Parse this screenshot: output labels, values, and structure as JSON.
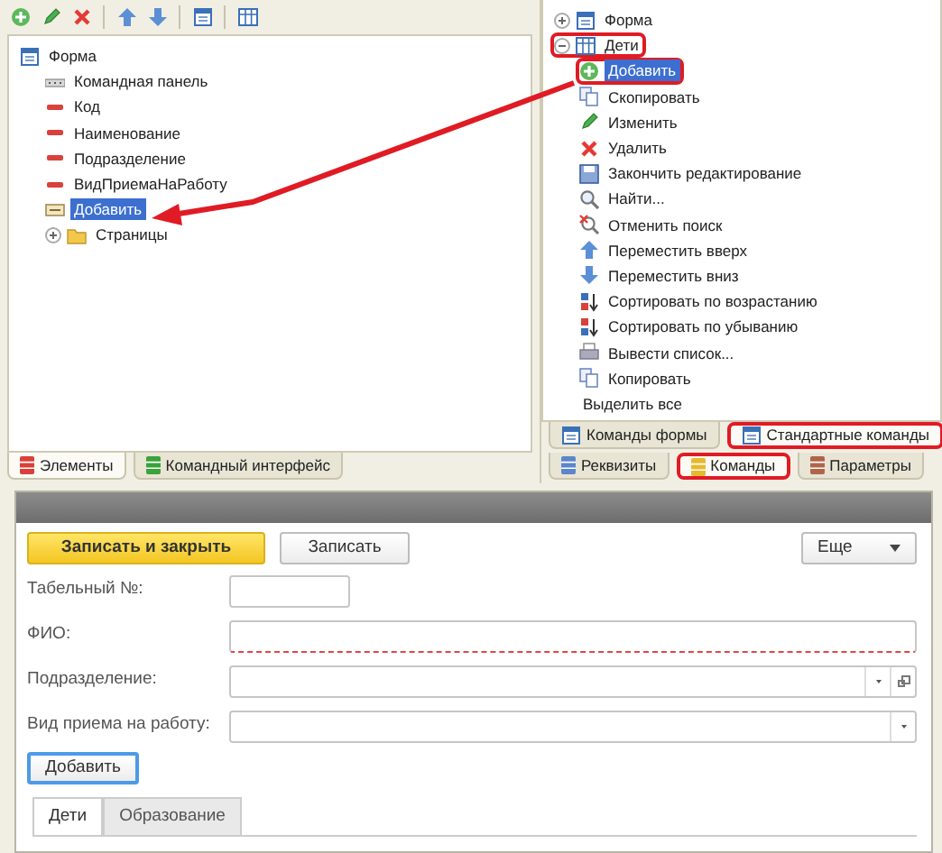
{
  "elements_panel": {
    "tree": [
      {
        "label": "Форма",
        "kind": "form",
        "selected": false,
        "children": [
          {
            "label": "Командная панель",
            "kind": "command-panel",
            "selected": false
          },
          {
            "label": "Код",
            "kind": "field",
            "selected": false
          },
          {
            "label": "Наименование",
            "kind": "field",
            "selected": false
          },
          {
            "label": "Подразделение",
            "kind": "field",
            "selected": false
          },
          {
            "label": "ВидПриемаНаРаботу",
            "kind": "field",
            "selected": false
          },
          {
            "label": "Добавить",
            "kind": "button",
            "selected": true
          },
          {
            "label": "Страницы",
            "kind": "folder",
            "selected": false,
            "expanded": false
          }
        ]
      }
    ],
    "tabs": [
      {
        "label": "Элементы",
        "color": "#d9413a",
        "selected": true
      },
      {
        "label": "Командный интерфейс",
        "color": "#3aa33a",
        "selected": false
      }
    ]
  },
  "commands_panel": {
    "tree": [
      {
        "label": "Форма",
        "kind": "form",
        "selected": false,
        "highlighted": false,
        "expanded": false
      },
      {
        "label": "Дети",
        "kind": "table",
        "selected": false,
        "highlighted": true,
        "expanded": true,
        "children": [
          {
            "label": "Добавить",
            "kind": "add",
            "selected": true,
            "highlighted": true
          },
          {
            "label": "Скопировать",
            "kind": "copy",
            "selected": false,
            "highlighted": false
          },
          {
            "label": "Изменить",
            "kind": "edit",
            "selected": false,
            "highlighted": false
          },
          {
            "label": "Удалить",
            "kind": "delete",
            "selected": false,
            "highlighted": false
          },
          {
            "label": "Закончить редактирование",
            "kind": "end-edit",
            "selected": false,
            "highlighted": false
          },
          {
            "label": "Найти...",
            "kind": "find",
            "selected": false,
            "highlighted": false
          },
          {
            "label": "Отменить поиск",
            "kind": "cancel-find",
            "selected": false,
            "highlighted": false
          },
          {
            "label": "Переместить вверх",
            "kind": "up",
            "selected": false,
            "highlighted": false
          },
          {
            "label": "Переместить вниз",
            "kind": "down",
            "selected": false,
            "highlighted": false
          },
          {
            "label": "Сортировать по возрастанию",
            "kind": "sort-asc",
            "selected": false,
            "highlighted": false
          },
          {
            "label": "Сортировать по убыванию",
            "kind": "sort-desc",
            "selected": false,
            "highlighted": false
          },
          {
            "label": "Вывести список...",
            "kind": "print",
            "selected": false,
            "highlighted": false
          },
          {
            "label": "Копировать",
            "kind": "copy",
            "selected": false,
            "highlighted": false
          },
          {
            "label": "Выделить все",
            "kind": "none",
            "selected": false,
            "highlighted": false
          }
        ]
      }
    ],
    "subtabs": [
      {
        "label": "Команды формы",
        "selected": false,
        "highlighted": false
      },
      {
        "label": "Стандартные команды",
        "selected": true,
        "highlighted": true
      }
    ],
    "tabs": [
      {
        "label": "Реквизиты",
        "color": "#5b86c9",
        "selected": false,
        "highlighted": false
      },
      {
        "label": "Команды",
        "color": "#e8b92e",
        "selected": true,
        "highlighted": true
      },
      {
        "label": "Параметры",
        "color": "#b0654a",
        "selected": false,
        "highlighted": false
      }
    ]
  },
  "form_preview": {
    "commands": [
      {
        "label": "Записать и закрыть",
        "kind": "default"
      },
      {
        "label": "Записать",
        "kind": "normal"
      }
    ],
    "more_button": {
      "label": "Еще"
    },
    "fields": [
      {
        "label": "Табельный №:",
        "kind": "short",
        "required": false
      },
      {
        "label": "ФИО:",
        "kind": "text",
        "required": true
      },
      {
        "label": "Подразделение:",
        "kind": "select-open",
        "required": false
      },
      {
        "label": "Вид приема на работу:",
        "kind": "select",
        "required": false
      }
    ],
    "add_button": {
      "label": "Добавить",
      "focused": true
    },
    "tabs": [
      {
        "label": "Дети",
        "selected": true
      },
      {
        "label": "Образование",
        "selected": false
      }
    ]
  }
}
